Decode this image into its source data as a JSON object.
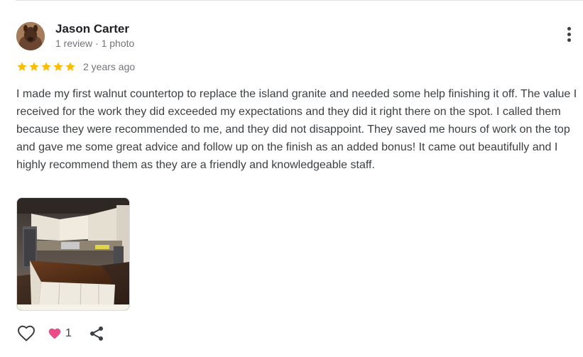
{
  "review": {
    "author_name": "Jason Carter",
    "author_meta": "1 review · 1 photo",
    "rating": 5,
    "rating_max": 5,
    "time": "2 years ago",
    "text": "I made my first walnut countertop to replace the island granite and needed some help finishing it off. The value I received for the work they did exceeded my expectations and they did it right there on the spot. I called them because they were recommended to me, and they did not disappoint. They saved me hours of work on the top and gave me some great advice and follow up on the finish as an added bonus! It came out beautifully and I highly recommend them as they are a friendly and knowledgeable staff.",
    "reaction_count": "1"
  },
  "icons": {
    "more": "more-vert-icon",
    "star": "star-icon",
    "like": "heart-outline-icon",
    "reaction": "heart-filled-icon",
    "share": "share-icon"
  },
  "colors": {
    "star": "#fbbc04",
    "reaction_heart": "#ea4c89",
    "meta_text": "#70757a"
  }
}
